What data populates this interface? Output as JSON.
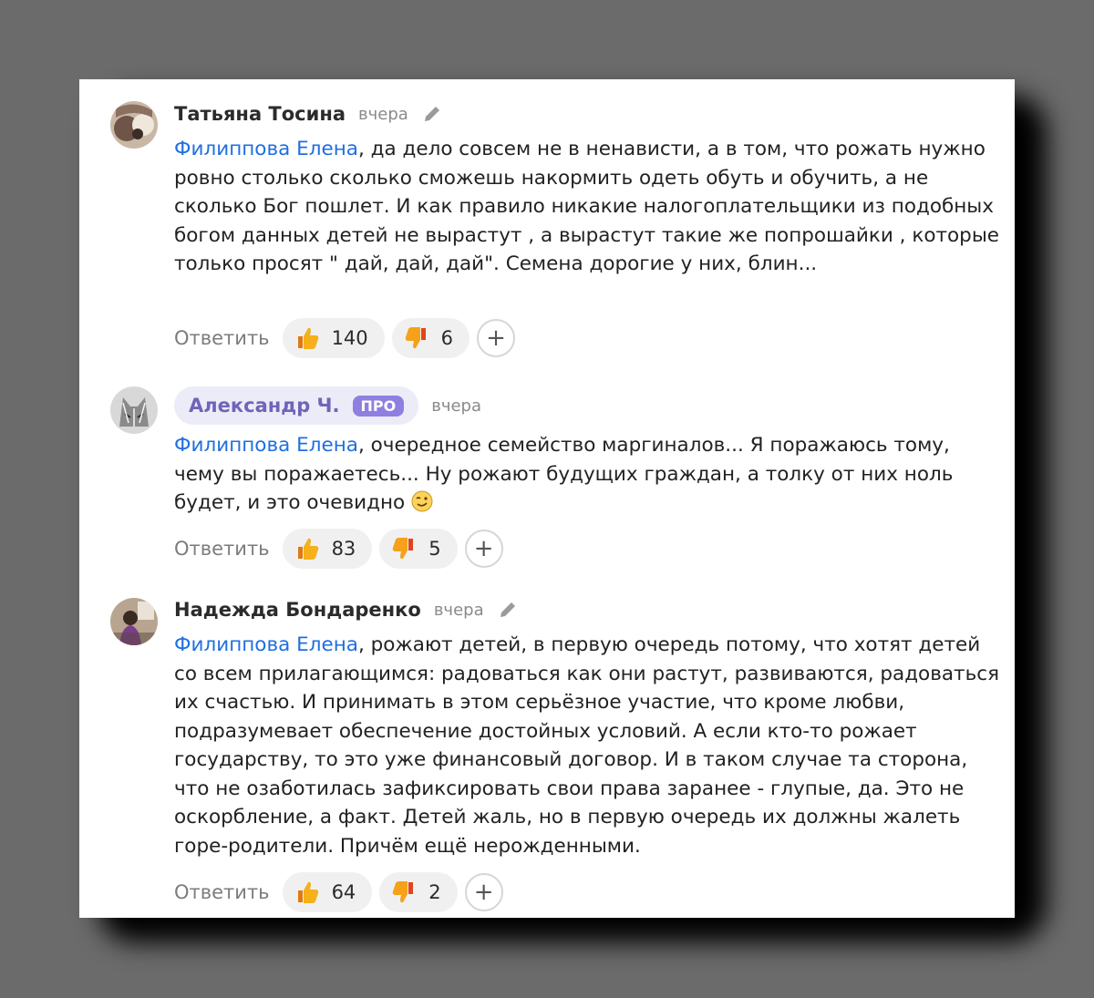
{
  "comments": [
    {
      "author": "Татьяна Тосина",
      "time": "вчера",
      "mention": "Филиппова Елена",
      "text": ", да дело совсем не в ненависти, а в том, что рожать нужно ровно столько сколько сможешь накормить одеть обуть и обучить, а не сколько Бог пошлет. И как правило никакие налогоплательщики из подобных богом данных детей не вырастут , а вырастут такие же попрошайки , которые только просят \" дай, дай, дай\". Семена дорогие у них, блин...",
      "reply": "Ответить",
      "likes": "140",
      "dislikes": "6",
      "add": "+"
    },
    {
      "author": "Александр Ч.",
      "badge": "ПРО",
      "time": "вчера",
      "mention": "Филиппова Елена",
      "text": ", очередное семейство маргиналов... Я поражаюсь тому, чему вы поражаетесь... Ну рожают будущих граждан, а толку от них ноль будет, и это очевидно",
      "reply": "Ответить",
      "likes": "83",
      "dislikes": "5",
      "add": "+"
    },
    {
      "author": "Надежда Бондаренко",
      "time": "вчера",
      "mention": "Филиппова Елена",
      "text": ", рожают детей, в первую очередь потому, что хотят детей со всем прилагающимся: радоваться как они растут, развиваются, радоваться их счастью. И принимать в этом серьёзное участие, что кроме любви, подразумевает обеспечение достойных условий. А если кто-то рожает государству, то это уже финансовый договор. И в таком случае та сторона, что не озаботилась зафиксировать свои права заранее - глупые, да. Это не оскорбление, а факт. Детей жаль, но в первую очередь их должны жалеть горе-родители. Причём ещё нерожденными.",
      "reply": "Ответить",
      "likes": "64",
      "dislikes": "2",
      "add": "+"
    }
  ],
  "icons": {
    "edit": "pencil-icon",
    "like": "thumbs-up-icon",
    "dislike": "thumbs-down-icon",
    "wink": "wink-emoji-icon"
  },
  "colors": {
    "mention": "#1f6fe0",
    "pro_badge": "#8f7fe0",
    "pill_bg": "#f0f0f0"
  }
}
